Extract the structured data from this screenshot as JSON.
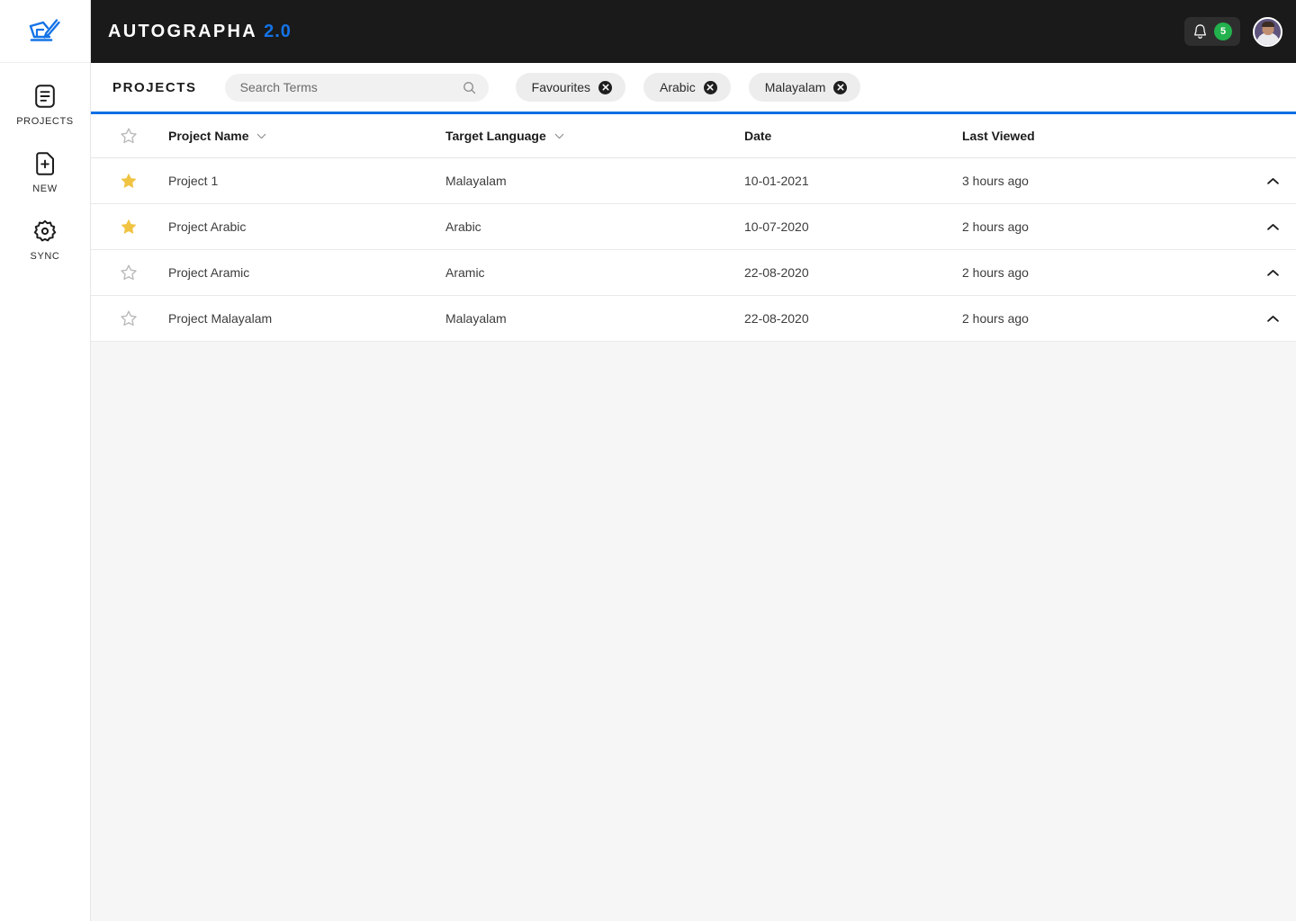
{
  "app": {
    "brand_name": "AUTOGRAPHA",
    "brand_version": "2.0",
    "accent_blue": "#0a6fe4",
    "brand_blue": "#1473e6",
    "star_gold": "#f0c343",
    "badge_green": "#22b14c",
    "topbar_bg": "#1a1a1a"
  },
  "sidebar": {
    "logo_icon": "quill-pen-icon",
    "items": [
      {
        "label": "PROJECTS",
        "icon": "document-list-icon"
      },
      {
        "label": "NEW",
        "icon": "document-plus-icon"
      },
      {
        "label": "SYNC",
        "icon": "gear-icon"
      }
    ]
  },
  "topbar": {
    "notifications": {
      "icon": "bell-icon",
      "count": "5"
    },
    "avatar": "user-avatar"
  },
  "toolbar": {
    "page_title": "PROJECTS",
    "search": {
      "placeholder": "Search Terms",
      "value": "",
      "icon": "search-icon"
    },
    "chips": [
      {
        "label": "Favourites"
      },
      {
        "label": "Arabic"
      },
      {
        "label": "Malayalam"
      }
    ]
  },
  "table": {
    "columns": [
      {
        "key": "star",
        "label": "",
        "sortable": false
      },
      {
        "key": "name",
        "label": "Project Name",
        "sortable": true
      },
      {
        "key": "language",
        "label": "Target Language",
        "sortable": true
      },
      {
        "key": "date",
        "label": "Date",
        "sortable": false
      },
      {
        "key": "last_viewed",
        "label": "Last Viewed",
        "sortable": false
      }
    ],
    "rows": [
      {
        "favourite": true,
        "name": "Project 1",
        "language": "Malayalam",
        "date": "10-01-2021",
        "last_viewed": "3 hours ago",
        "expand_icon": "chevron-up-icon"
      },
      {
        "favourite": true,
        "name": "Project Arabic",
        "language": "Arabic",
        "date": "10-07-2020",
        "last_viewed": "2 hours ago",
        "expand_icon": "chevron-up-icon"
      },
      {
        "favourite": false,
        "name": "Project Aramic",
        "language": "Aramic",
        "date": "22-08-2020",
        "last_viewed": "2 hours ago",
        "expand_icon": "chevron-up-icon"
      },
      {
        "favourite": false,
        "name": "Project Malayalam",
        "language": "Malayalam",
        "date": "22-08-2020",
        "last_viewed": "2 hours ago",
        "expand_icon": "chevron-up-icon"
      }
    ]
  }
}
